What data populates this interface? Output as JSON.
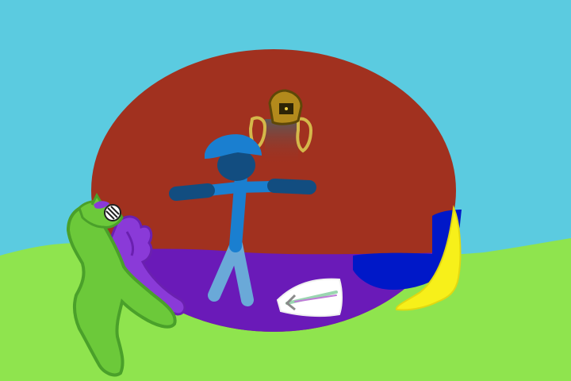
{
  "scene": {
    "colors": {
      "sky": "#5bcbe0",
      "grass": "#8fe44e",
      "oval_top": "#a1311f",
      "oval_floor": "#6a1ab8",
      "stick_figure": "#1a7fd0",
      "stick_figure_dark": "#124d80",
      "stick_legs": "#6aa9d8",
      "cat": "#6cc93a",
      "cat_outline": "#4aa02a",
      "purple_creature": "#8a3ad8",
      "helmet": "#b38a1c",
      "robot_body": "#6c6c6c",
      "blue_block": "#0018c8",
      "yellow_shape": "#f7f01a",
      "white_item": "#ffffff"
    },
    "icons": [
      "green-cat",
      "stick-figure",
      "gold-helmet-robot",
      "purple-creature",
      "white-sword",
      "blue-block",
      "yellow-shape"
    ]
  }
}
